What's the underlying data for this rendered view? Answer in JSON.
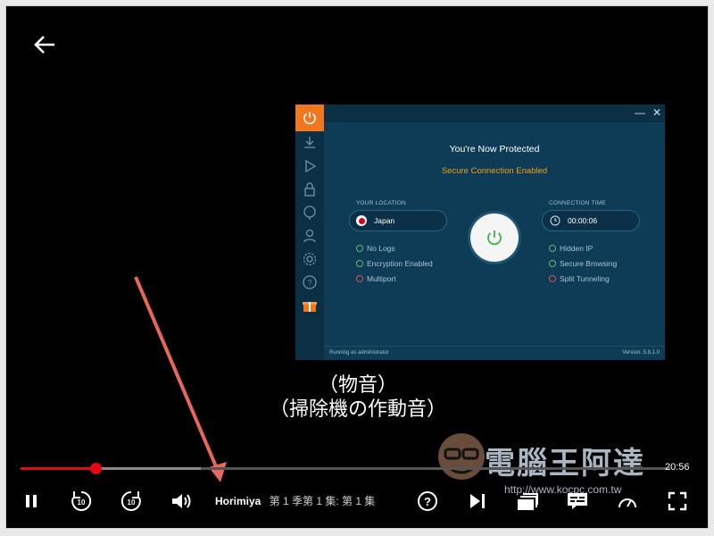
{
  "vpn": {
    "title": "You're Now Protected",
    "status": "Secure Connection Enabled",
    "location_label": "YOUR LOCATION",
    "location_value": "Japan",
    "connection_label": "CONNECTION TIME",
    "connection_value": "00:00:06",
    "features_left": [
      "No Logs",
      "Encryption Enabled",
      "Multiport"
    ],
    "features_right": [
      "Hidden IP",
      "Secure Browsing",
      "Split Tunneling"
    ],
    "footer_left": "Running as administrator",
    "footer_right": "Version: 5.8.1.0",
    "minimize": "—",
    "close": "✕",
    "accent": "#f0771e"
  },
  "subtitles": {
    "line1": "（物音）",
    "line2": "（掃除機の作動音）"
  },
  "player": {
    "remaining_time": "20:56",
    "show_title": "Horimiya",
    "episode_info": "第 1 季第 1 集:  第 1 集",
    "progress_fraction": 0.115,
    "accent": "#e50914"
  },
  "watermark": {
    "text": "電腦王阿達",
    "url": "http://www.kocpc.com.tw"
  }
}
